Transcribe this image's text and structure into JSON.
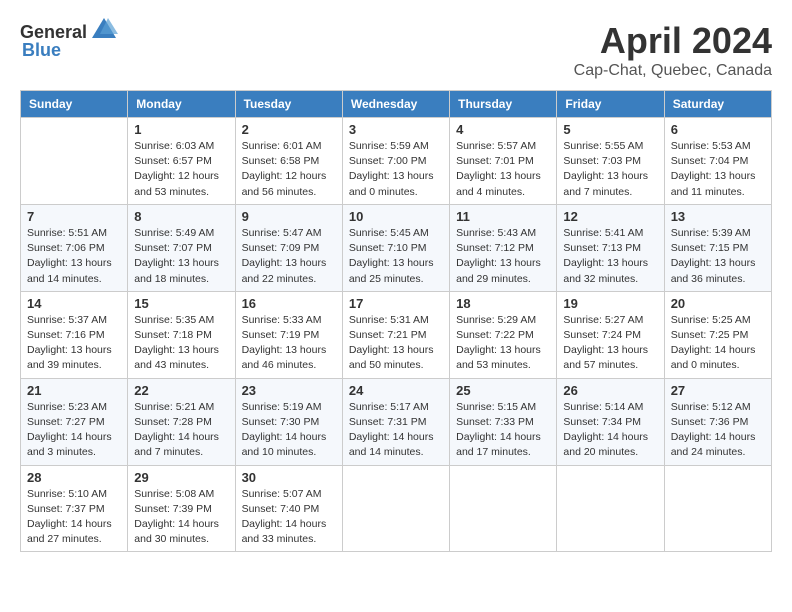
{
  "header": {
    "logo_general": "General",
    "logo_blue": "Blue",
    "month": "April 2024",
    "location": "Cap-Chat, Quebec, Canada"
  },
  "days_of_week": [
    "Sunday",
    "Monday",
    "Tuesday",
    "Wednesday",
    "Thursday",
    "Friday",
    "Saturday"
  ],
  "weeks": [
    [
      {
        "day": "",
        "info": ""
      },
      {
        "day": "1",
        "info": "Sunrise: 6:03 AM\nSunset: 6:57 PM\nDaylight: 12 hours\nand 53 minutes."
      },
      {
        "day": "2",
        "info": "Sunrise: 6:01 AM\nSunset: 6:58 PM\nDaylight: 12 hours\nand 56 minutes."
      },
      {
        "day": "3",
        "info": "Sunrise: 5:59 AM\nSunset: 7:00 PM\nDaylight: 13 hours\nand 0 minutes."
      },
      {
        "day": "4",
        "info": "Sunrise: 5:57 AM\nSunset: 7:01 PM\nDaylight: 13 hours\nand 4 minutes."
      },
      {
        "day": "5",
        "info": "Sunrise: 5:55 AM\nSunset: 7:03 PM\nDaylight: 13 hours\nand 7 minutes."
      },
      {
        "day": "6",
        "info": "Sunrise: 5:53 AM\nSunset: 7:04 PM\nDaylight: 13 hours\nand 11 minutes."
      }
    ],
    [
      {
        "day": "7",
        "info": "Sunrise: 5:51 AM\nSunset: 7:06 PM\nDaylight: 13 hours\nand 14 minutes."
      },
      {
        "day": "8",
        "info": "Sunrise: 5:49 AM\nSunset: 7:07 PM\nDaylight: 13 hours\nand 18 minutes."
      },
      {
        "day": "9",
        "info": "Sunrise: 5:47 AM\nSunset: 7:09 PM\nDaylight: 13 hours\nand 22 minutes."
      },
      {
        "day": "10",
        "info": "Sunrise: 5:45 AM\nSunset: 7:10 PM\nDaylight: 13 hours\nand 25 minutes."
      },
      {
        "day": "11",
        "info": "Sunrise: 5:43 AM\nSunset: 7:12 PM\nDaylight: 13 hours\nand 29 minutes."
      },
      {
        "day": "12",
        "info": "Sunrise: 5:41 AM\nSunset: 7:13 PM\nDaylight: 13 hours\nand 32 minutes."
      },
      {
        "day": "13",
        "info": "Sunrise: 5:39 AM\nSunset: 7:15 PM\nDaylight: 13 hours\nand 36 minutes."
      }
    ],
    [
      {
        "day": "14",
        "info": "Sunrise: 5:37 AM\nSunset: 7:16 PM\nDaylight: 13 hours\nand 39 minutes."
      },
      {
        "day": "15",
        "info": "Sunrise: 5:35 AM\nSunset: 7:18 PM\nDaylight: 13 hours\nand 43 minutes."
      },
      {
        "day": "16",
        "info": "Sunrise: 5:33 AM\nSunset: 7:19 PM\nDaylight: 13 hours\nand 46 minutes."
      },
      {
        "day": "17",
        "info": "Sunrise: 5:31 AM\nSunset: 7:21 PM\nDaylight: 13 hours\nand 50 minutes."
      },
      {
        "day": "18",
        "info": "Sunrise: 5:29 AM\nSunset: 7:22 PM\nDaylight: 13 hours\nand 53 minutes."
      },
      {
        "day": "19",
        "info": "Sunrise: 5:27 AM\nSunset: 7:24 PM\nDaylight: 13 hours\nand 57 minutes."
      },
      {
        "day": "20",
        "info": "Sunrise: 5:25 AM\nSunset: 7:25 PM\nDaylight: 14 hours\nand 0 minutes."
      }
    ],
    [
      {
        "day": "21",
        "info": "Sunrise: 5:23 AM\nSunset: 7:27 PM\nDaylight: 14 hours\nand 3 minutes."
      },
      {
        "day": "22",
        "info": "Sunrise: 5:21 AM\nSunset: 7:28 PM\nDaylight: 14 hours\nand 7 minutes."
      },
      {
        "day": "23",
        "info": "Sunrise: 5:19 AM\nSunset: 7:30 PM\nDaylight: 14 hours\nand 10 minutes."
      },
      {
        "day": "24",
        "info": "Sunrise: 5:17 AM\nSunset: 7:31 PM\nDaylight: 14 hours\nand 14 minutes."
      },
      {
        "day": "25",
        "info": "Sunrise: 5:15 AM\nSunset: 7:33 PM\nDaylight: 14 hours\nand 17 minutes."
      },
      {
        "day": "26",
        "info": "Sunrise: 5:14 AM\nSunset: 7:34 PM\nDaylight: 14 hours\nand 20 minutes."
      },
      {
        "day": "27",
        "info": "Sunrise: 5:12 AM\nSunset: 7:36 PM\nDaylight: 14 hours\nand 24 minutes."
      }
    ],
    [
      {
        "day": "28",
        "info": "Sunrise: 5:10 AM\nSunset: 7:37 PM\nDaylight: 14 hours\nand 27 minutes."
      },
      {
        "day": "29",
        "info": "Sunrise: 5:08 AM\nSunset: 7:39 PM\nDaylight: 14 hours\nand 30 minutes."
      },
      {
        "day": "30",
        "info": "Sunrise: 5:07 AM\nSunset: 7:40 PM\nDaylight: 14 hours\nand 33 minutes."
      },
      {
        "day": "",
        "info": ""
      },
      {
        "day": "",
        "info": ""
      },
      {
        "day": "",
        "info": ""
      },
      {
        "day": "",
        "info": ""
      }
    ]
  ]
}
